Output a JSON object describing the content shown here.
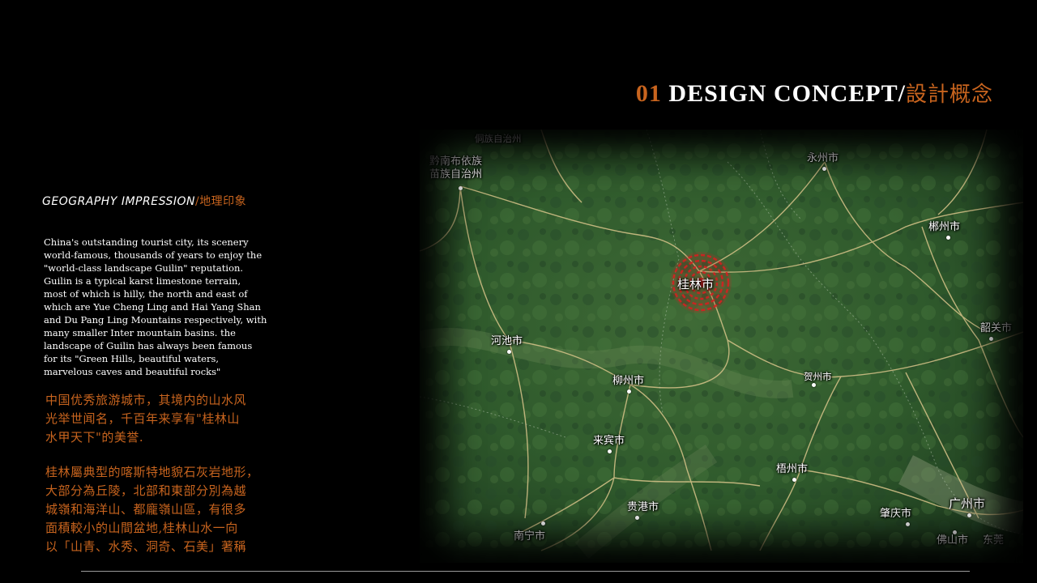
{
  "header": {
    "number": "01",
    "title": "DESIGN CONCEPT",
    "separator": "/",
    "title_cn": "設計概念"
  },
  "section": {
    "title": "GEOGRAPHY IMPRESSION",
    "separator": "/",
    "title_cn": "地理印象"
  },
  "body": {
    "english": "China's outstanding tourist city, its scenery\nworld-famous, thousands of years to enjoy the\n\"world-class landscape Guilin\" reputation.\nGuilin is a typical karst limestone terrain,\nmost of which is hilly, the north and east of\nwhich are Yue Cheng Ling and Hai Yang Shan\nand Du Pang Ling Mountains respectively, with\nmany smaller Inter mountain basins. the\nlandscape of Guilin has always been famous\nfor its \"Green Hills, beautiful waters,\nmarvelous caves and beautiful rocks\"",
    "chinese_1": "中国优秀旅游城市，其境内的山水风\n光举世闻名，千百年来享有\"桂林山\n水甲天下\"的美誉.",
    "chinese_2": "桂林屬典型的喀斯特地貌石灰岩地形，\n大部分為丘陵，北部和東部分別為越\n城嶺和海洋山、都龐嶺山區，有很多\n面積較小的山間盆地,桂林山水一向\n以「山青、水秀、洞奇、石美」著稱"
  },
  "map": {
    "highlight": "桂林市",
    "highlight_color": "#d42020",
    "cities": {
      "qiannan_top": "侗族自治州",
      "qiannan": "黔南布依族\n苗族自治州",
      "yongzhou": "永州市",
      "chenzhou": "郴州市",
      "guilin": "桂林市",
      "hechi": "河池市",
      "shaoguan": "韶关市",
      "liuzhou": "柳州市",
      "hezhou": "贺州市",
      "laibin": "来宾市",
      "wuzhou": "梧州市",
      "guigang": "贵港市",
      "zhaoqing": "肇庆市",
      "guangzhou": "广州市",
      "nanning": "南宁市",
      "foshan": "佛山市",
      "dongguan": "东莞"
    }
  }
}
